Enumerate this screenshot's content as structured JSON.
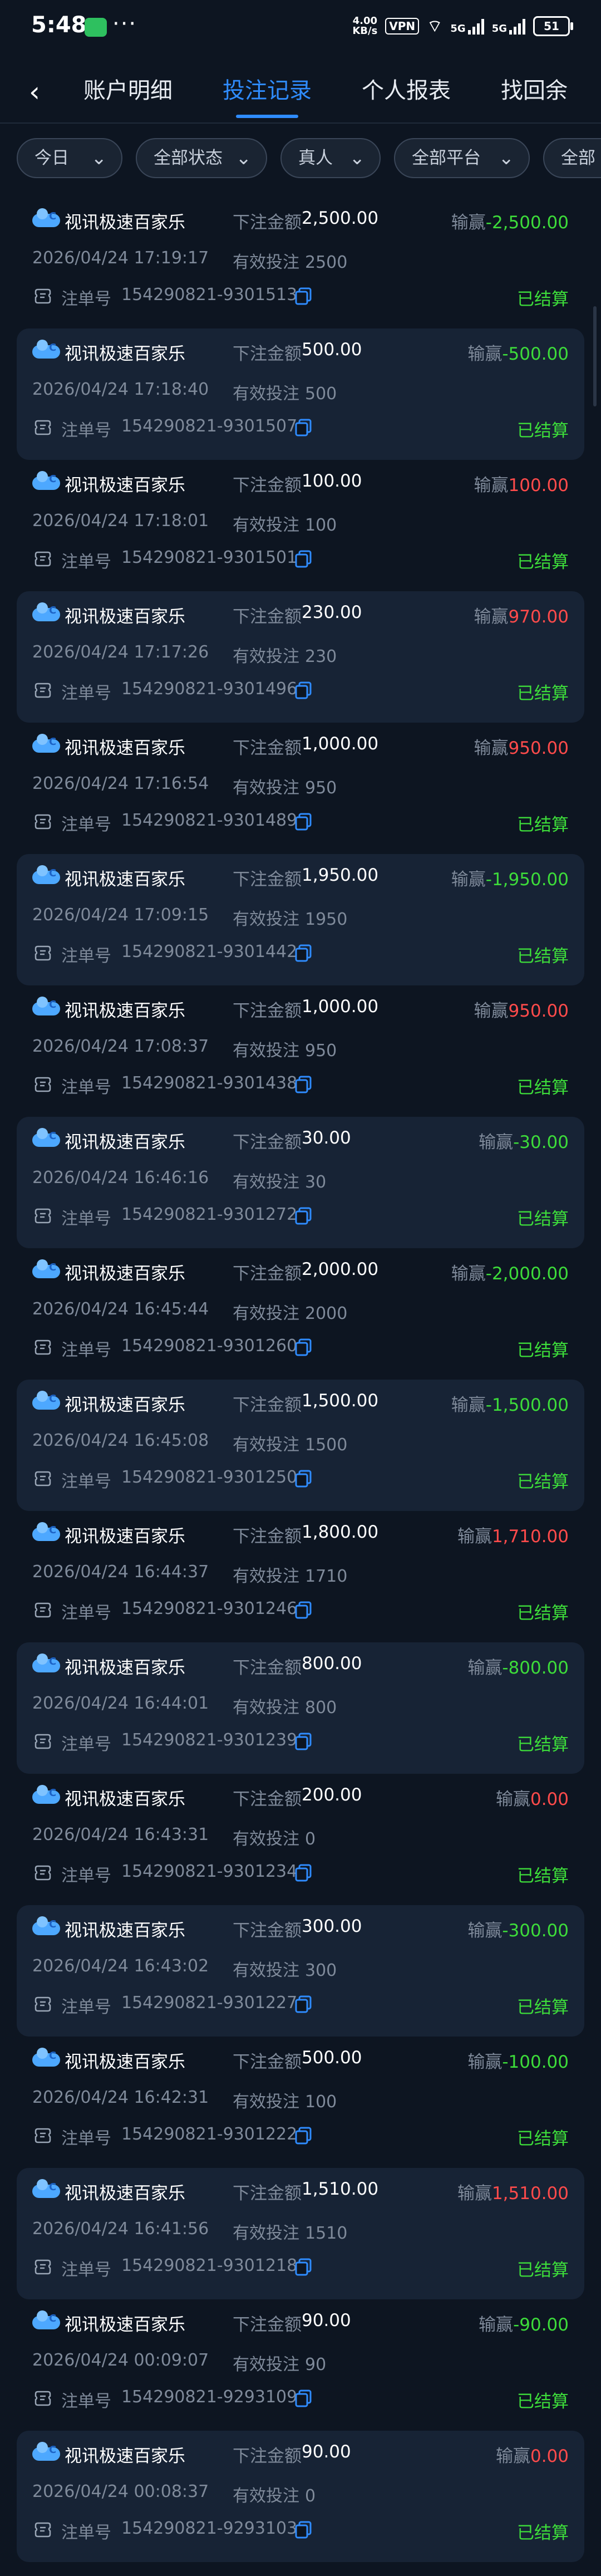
{
  "status_bar": {
    "time": "5:48",
    "net_speed_top": "4.00",
    "net_speed_bottom": "KB/s",
    "vpn": "VPN",
    "signal1": "5G",
    "signal2": "5G",
    "battery": "51"
  },
  "nav": {
    "tabs": [
      {
        "label": "账户明细",
        "active": false
      },
      {
        "label": "投注记录",
        "active": true
      },
      {
        "label": "个人报表",
        "active": false
      },
      {
        "label": "找回余",
        "active": false
      }
    ]
  },
  "filters": [
    {
      "label": "今日"
    },
    {
      "label": "全部状态"
    },
    {
      "label": "真人"
    },
    {
      "label": "全部平台"
    },
    {
      "label": "全部"
    }
  ],
  "labels": {
    "bet_amount": "下注金额",
    "effective_bet": "有效投注",
    "win_loss": "输赢",
    "order_no": "注单号"
  },
  "records": [
    {
      "game": "视讯极速百家乐",
      "bet": "2,500.00",
      "win": "-2,500.00",
      "sign": "neg",
      "time": "2026/04/24 17:19:17",
      "effective": "2500",
      "order": "154290821-9301513",
      "status": "已结算"
    },
    {
      "game": "视讯极速百家乐",
      "bet": "500.00",
      "win": "-500.00",
      "sign": "neg",
      "time": "2026/04/24 17:18:40",
      "effective": "500",
      "order": "154290821-9301507",
      "status": "已结算"
    },
    {
      "game": "视讯极速百家乐",
      "bet": "100.00",
      "win": "100.00",
      "sign": "pos",
      "time": "2026/04/24 17:18:01",
      "effective": "100",
      "order": "154290821-9301501",
      "status": "已结算"
    },
    {
      "game": "视讯极速百家乐",
      "bet": "230.00",
      "win": "970.00",
      "sign": "pos",
      "time": "2026/04/24 17:17:26",
      "effective": "230",
      "order": "154290821-9301496",
      "status": "已结算"
    },
    {
      "game": "视讯极速百家乐",
      "bet": "1,000.00",
      "win": "950.00",
      "sign": "pos",
      "time": "2026/04/24 17:16:54",
      "effective": "950",
      "order": "154290821-9301489",
      "status": "已结算"
    },
    {
      "game": "视讯极速百家乐",
      "bet": "1,950.00",
      "win": "-1,950.00",
      "sign": "neg",
      "time": "2026/04/24 17:09:15",
      "effective": "1950",
      "order": "154290821-9301442",
      "status": "已结算"
    },
    {
      "game": "视讯极速百家乐",
      "bet": "1,000.00",
      "win": "950.00",
      "sign": "pos",
      "time": "2026/04/24 17:08:37",
      "effective": "950",
      "order": "154290821-9301438",
      "status": "已结算"
    },
    {
      "game": "视讯极速百家乐",
      "bet": "30.00",
      "win": "-30.00",
      "sign": "neg",
      "time": "2026/04/24 16:46:16",
      "effective": "30",
      "order": "154290821-9301272",
      "status": "已结算"
    },
    {
      "game": "视讯极速百家乐",
      "bet": "2,000.00",
      "win": "-2,000.00",
      "sign": "neg",
      "time": "2026/04/24 16:45:44",
      "effective": "2000",
      "order": "154290821-9301260",
      "status": "已结算"
    },
    {
      "game": "视讯极速百家乐",
      "bet": "1,500.00",
      "win": "-1,500.00",
      "sign": "neg",
      "time": "2026/04/24 16:45:08",
      "effective": "1500",
      "order": "154290821-9301250",
      "status": "已结算"
    },
    {
      "game": "视讯极速百家乐",
      "bet": "1,800.00",
      "win": "1,710.00",
      "sign": "pos",
      "time": "2026/04/24 16:44:37",
      "effective": "1710",
      "order": "154290821-9301246",
      "status": "已结算"
    },
    {
      "game": "视讯极速百家乐",
      "bet": "800.00",
      "win": "-800.00",
      "sign": "neg",
      "time": "2026/04/24 16:44:01",
      "effective": "800",
      "order": "154290821-9301239",
      "status": "已结算"
    },
    {
      "game": "视讯极速百家乐",
      "bet": "200.00",
      "win": "0.00",
      "sign": "zero",
      "time": "2026/04/24 16:43:31",
      "effective": "0",
      "order": "154290821-9301234",
      "status": "已结算"
    },
    {
      "game": "视讯极速百家乐",
      "bet": "300.00",
      "win": "-300.00",
      "sign": "neg",
      "time": "2026/04/24 16:43:02",
      "effective": "300",
      "order": "154290821-9301227",
      "status": "已结算"
    },
    {
      "game": "视讯极速百家乐",
      "bet": "500.00",
      "win": "-100.00",
      "sign": "neg",
      "time": "2026/04/24 16:42:31",
      "effective": "100",
      "order": "154290821-9301222",
      "status": "已结算"
    },
    {
      "game": "视讯极速百家乐",
      "bet": "1,510.00",
      "win": "1,510.00",
      "sign": "pos",
      "time": "2026/04/24 16:41:56",
      "effective": "1510",
      "order": "154290821-9301218",
      "status": "已结算"
    },
    {
      "game": "视讯极速百家乐",
      "bet": "90.00",
      "win": "-90.00",
      "sign": "neg",
      "time": "2026/04/24 00:09:07",
      "effective": "90",
      "order": "154290821-9293109",
      "status": "已结算"
    },
    {
      "game": "视讯极速百家乐",
      "bet": "90.00",
      "win": "0.00",
      "sign": "zero",
      "time": "2026/04/24 00:08:37",
      "effective": "0",
      "order": "154290821-9293103",
      "status": "已结算"
    }
  ]
}
